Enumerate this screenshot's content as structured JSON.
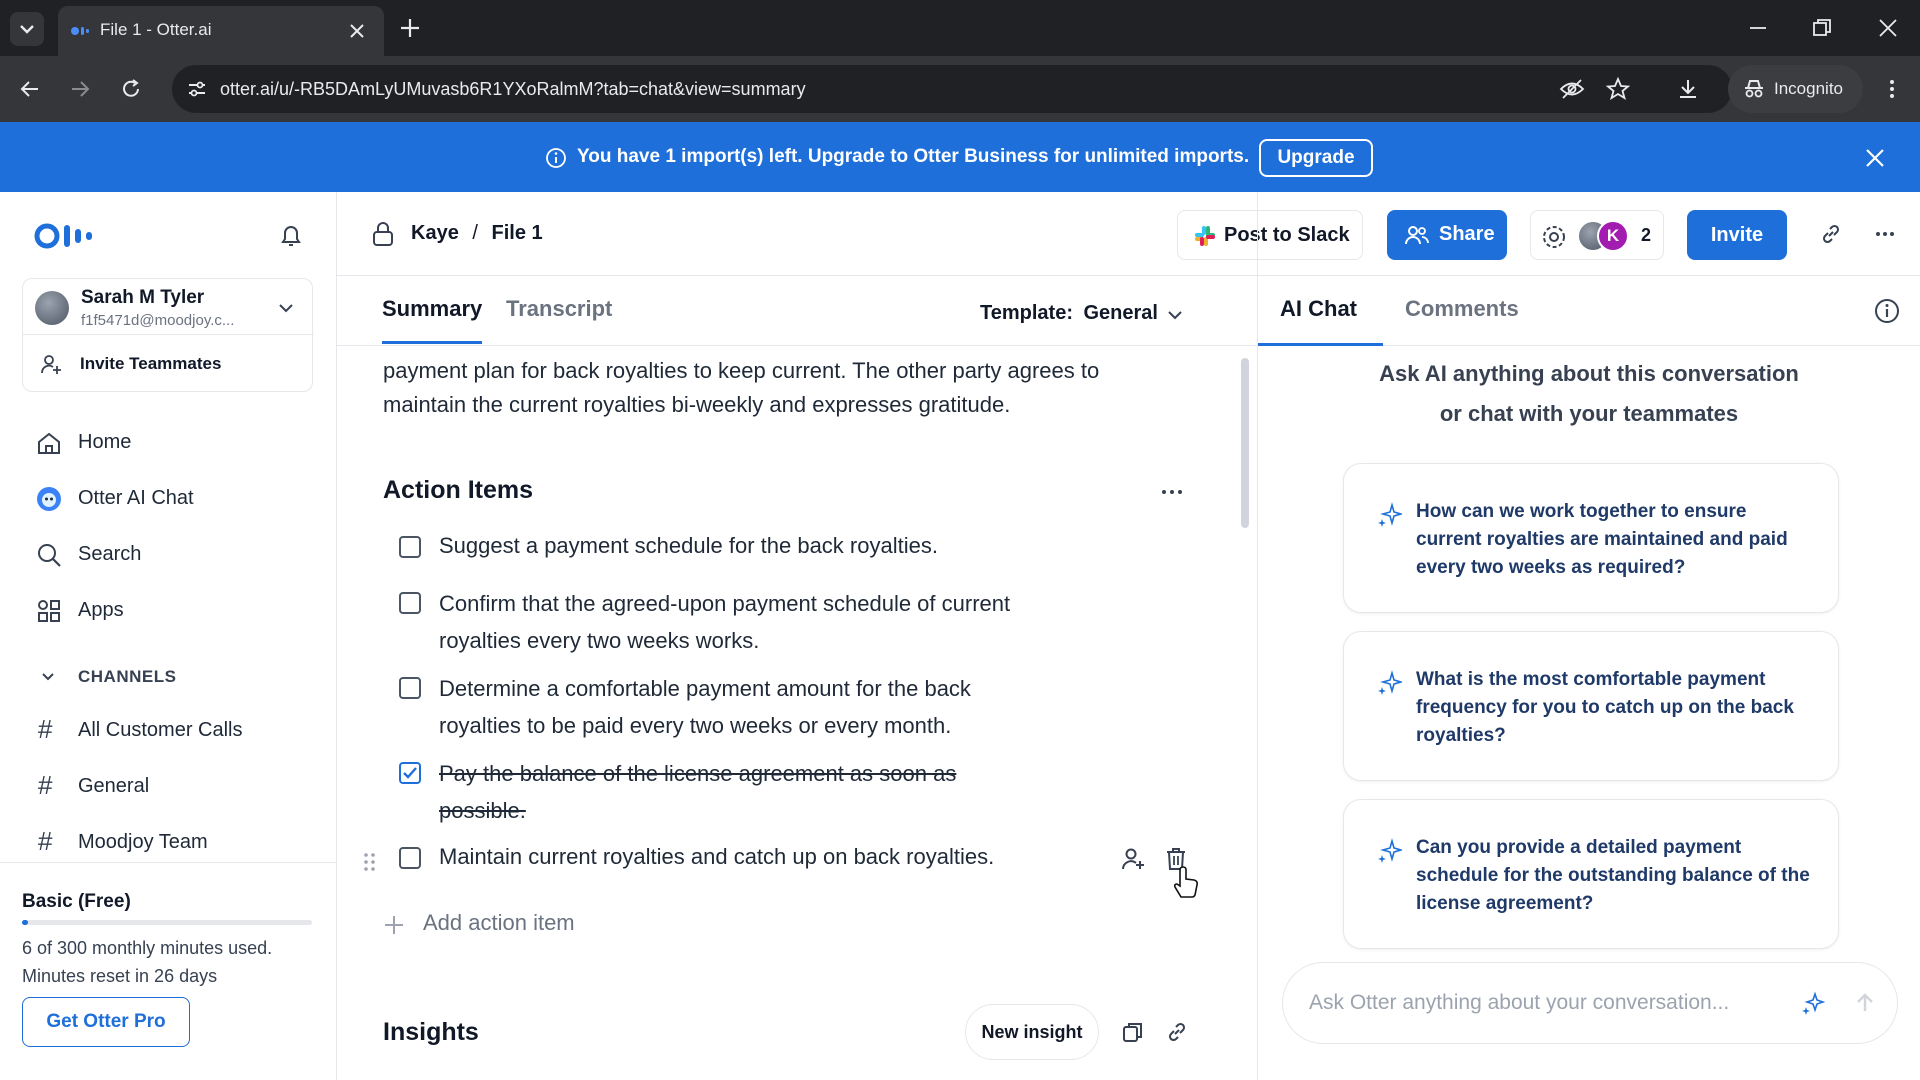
{
  "browser": {
    "tab_title": "File 1 - Otter.ai",
    "url": "otter.ai/u/-RB5DAmLyUMuvasb6R1YXoRalmM?tab=chat&view=summary",
    "incognito_label": "Incognito"
  },
  "banner": {
    "message": "You have 1 import(s) left. Upgrade to Otter Business for unlimited imports.",
    "upgrade_label": "Upgrade"
  },
  "sidebar": {
    "user_name": "Sarah M Tyler",
    "user_email": "f1f5471d@moodjoy.c...",
    "invite_label": "Invite Teammates",
    "nav": [
      {
        "label": "Home",
        "icon": "home-icon"
      },
      {
        "label": "Otter AI Chat",
        "icon": "otter-chat-icon"
      },
      {
        "label": "Search",
        "icon": "search-icon"
      },
      {
        "label": "Apps",
        "icon": "apps-icon"
      }
    ],
    "channels_heading": "CHANNELS",
    "channels": [
      "All Customer Calls",
      "General",
      "Moodjoy Team"
    ],
    "plan": "Basic (Free)",
    "usage_line1": "6 of 300 monthly minutes used.",
    "usage_line2": "Minutes reset in 26 days",
    "usage_fraction": 0.02,
    "pro_button": "Get Otter Pro"
  },
  "header": {
    "breadcrumb_parent": "Kaye",
    "breadcrumb_sep": "/",
    "breadcrumb_current": "File 1",
    "post_slack": "Post to Slack",
    "share": "Share",
    "participant_initial": "K",
    "participant_count": "2",
    "invite": "Invite"
  },
  "main": {
    "tabs": [
      "Summary",
      "Transcript"
    ],
    "template_label": "Template:",
    "template_value": "General",
    "summary_partial_line1": "payment plan for back royalties to keep current. The other party agrees to",
    "summary_partial_line2": "maintain the current royalties bi-weekly and expresses gratitude.",
    "action_items_heading": "Action Items",
    "action_items": [
      {
        "lines": [
          "Suggest a payment schedule for the back royalties."
        ],
        "checked": false
      },
      {
        "lines": [
          "Confirm that the agreed-upon payment schedule of current",
          "royalties every two weeks works."
        ],
        "checked": false
      },
      {
        "lines": [
          "Determine a comfortable payment amount for the back",
          "royalties to be paid every two weeks or every month."
        ],
        "checked": false
      },
      {
        "lines": [
          "Pay the balance of the license agreement as soon as",
          "possible."
        ],
        "checked": true
      },
      {
        "lines": [
          "Maintain current royalties and catch up on back royalties."
        ],
        "checked": false
      }
    ],
    "add_action": "Add action item",
    "insights_heading": "Insights",
    "new_insight": "New insight"
  },
  "right": {
    "tabs": [
      "AI Chat",
      "Comments"
    ],
    "intro_line1": "Ask AI anything about this conversation",
    "intro_line2": "or chat with your teammates",
    "suggestions": [
      "How can we work together to ensure current royalties are maintained and paid every two weeks as required?",
      "What is the most comfortable payment frequency for you to catch up on the back royalties?",
      "Can you provide a detailed payment schedule for the outstanding balance of the license agreement?"
    ],
    "input_placeholder": "Ask Otter anything about your conversation..."
  },
  "colors": {
    "brand_blue": "#1e6fd9",
    "dark_navy": "#1f3a68"
  }
}
